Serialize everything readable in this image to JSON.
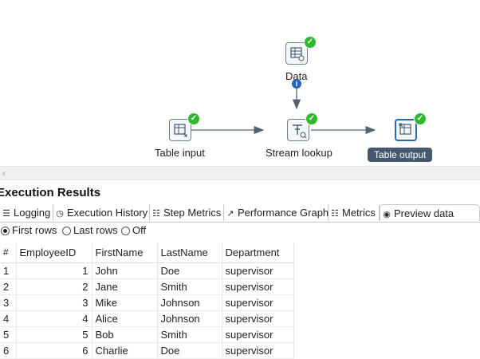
{
  "canvas": {
    "steps": {
      "data": {
        "label": "Data"
      },
      "table_input": {
        "label": "Table input"
      },
      "stream_lookup": {
        "label": "Stream lookup"
      },
      "table_output": {
        "label": "Table output"
      }
    },
    "info_glyph": "i",
    "check_glyph": "✓"
  },
  "results": {
    "title": "Execution Results",
    "tabs": [
      {
        "label": "Logging",
        "icon": "log-icon"
      },
      {
        "label": "Execution History",
        "icon": "history-icon"
      },
      {
        "label": "Step Metrics",
        "icon": "step-metrics-icon"
      },
      {
        "label": "Performance Graph",
        "icon": "graph-icon"
      },
      {
        "label": "Metrics",
        "icon": "metrics-icon"
      },
      {
        "label": "Preview data",
        "icon": "eye-icon"
      }
    ],
    "radios": [
      {
        "label": "First rows",
        "selected": true
      },
      {
        "label": "Last rows",
        "selected": false
      },
      {
        "label": "Off",
        "selected": false
      }
    ],
    "table": {
      "columns": [
        "#",
        "EmployeeID",
        "FirstName",
        "LastName",
        "Department"
      ],
      "rows": [
        [
          "1",
          "1",
          "John",
          "Doe",
          "supervisor"
        ],
        [
          "2",
          "2",
          "Jane",
          "Smith",
          "supervisor"
        ],
        [
          "3",
          "3",
          "Mike",
          "Johnson",
          "supervisor"
        ],
        [
          "4",
          "4",
          "Alice",
          "Johnson",
          "supervisor"
        ],
        [
          "5",
          "5",
          "Bob",
          "Smith",
          "supervisor"
        ],
        [
          "6",
          "6",
          "Charlie",
          "Doe",
          "supervisor"
        ]
      ]
    }
  }
}
